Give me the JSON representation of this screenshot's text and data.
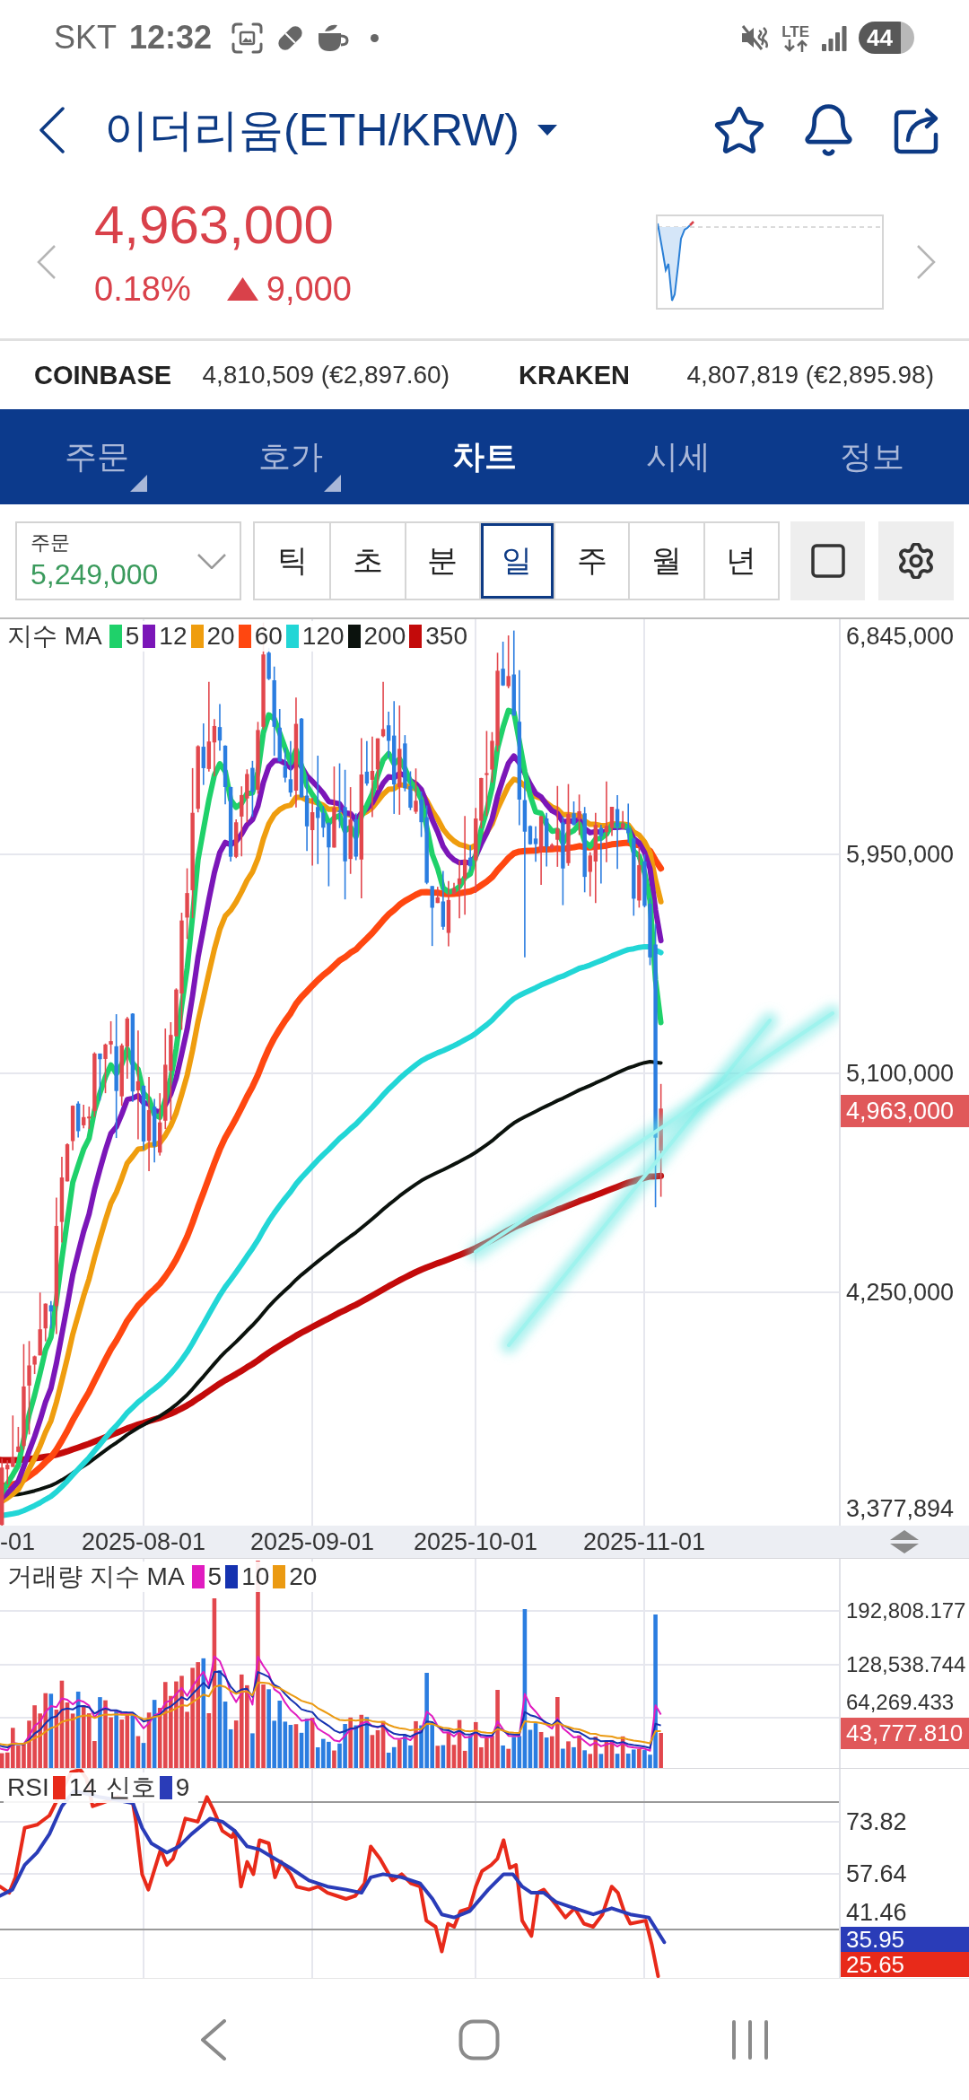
{
  "status_bar": {
    "carrier": "SKT",
    "time": "12:32",
    "network": "LTE",
    "battery": "44"
  },
  "header": {
    "title": "이더리움(ETH/KRW)"
  },
  "quote": {
    "price": "4,963,000",
    "change_rate": "0.18%",
    "change": "9,000",
    "rising": true
  },
  "exchanges": [
    {
      "name": "COINBASE",
      "price": "4,810,509 (€2,897.60)"
    },
    {
      "name": "KRAKEN",
      "price": "4,807,819 (€2,895.98)"
    }
  ],
  "tabs": [
    {
      "label": "주문",
      "selected": false,
      "submenu": true
    },
    {
      "label": "호가",
      "selected": false,
      "submenu": true
    },
    {
      "label": "차트",
      "selected": true,
      "submenu": false
    },
    {
      "label": "시세",
      "selected": false,
      "submenu": false
    },
    {
      "label": "정보",
      "selected": false,
      "submenu": false
    }
  ],
  "toolbar": {
    "order_select": {
      "label": "주문",
      "value": "5,249,000"
    },
    "periods": [
      {
        "label": "틱",
        "selected": false
      },
      {
        "label": "초",
        "selected": false
      },
      {
        "label": "분",
        "selected": false
      },
      {
        "label": "일",
        "selected": true
      },
      {
        "label": "주",
        "selected": false
      },
      {
        "label": "월",
        "selected": false
      },
      {
        "label": "년",
        "selected": false
      }
    ]
  },
  "price_chart": {
    "legend_title": "지수 MA",
    "moving_averages": [
      {
        "label": "5",
        "color": "#1fd16a"
      },
      {
        "label": "12",
        "color": "#7b16b8"
      },
      {
        "label": "20",
        "color": "#ef9d0e"
      },
      {
        "label": "60",
        "color": "#ff4710"
      },
      {
        "label": "120",
        "color": "#22d6d6"
      },
      {
        "label": "200",
        "color": "#0b120d"
      },
      {
        "label": "350",
        "color": "#c30a0a"
      }
    ],
    "y_ticks": [
      "6,845,000",
      "5,950,000",
      "5,100,000",
      "4,250,000",
      "3,377,894"
    ],
    "current_price": "4,963,000"
  },
  "time_axis": {
    "labels": [
      "-01",
      "2025-08-01",
      "2025-09-01",
      "2025-10-01",
      "2025-11-01"
    ]
  },
  "volume_chart": {
    "legend_title": "거래량 지수 MA",
    "moving_averages": [
      {
        "label": "5",
        "color": "#e01cc0"
      },
      {
        "label": "10",
        "color": "#1532b0"
      },
      {
        "label": "20",
        "color": "#eb9a12"
      }
    ],
    "y_ticks": [
      "192,808.177",
      "128,538.744",
      "64,269.433"
    ],
    "current_volume": "43,777.810"
  },
  "rsi_chart": {
    "series": [
      {
        "name": "RSI",
        "period": "14",
        "color": "#e82a1a"
      },
      {
        "name": "신호",
        "period": "9",
        "color": "#2a3cb8"
      }
    ],
    "y_ticks": [
      "73.82",
      "57.64",
      "41.46"
    ],
    "readings": [
      {
        "value": "35.95",
        "color": "#2a3cb8"
      },
      {
        "value": "25.65",
        "color": "#e82a1a"
      }
    ]
  }
}
